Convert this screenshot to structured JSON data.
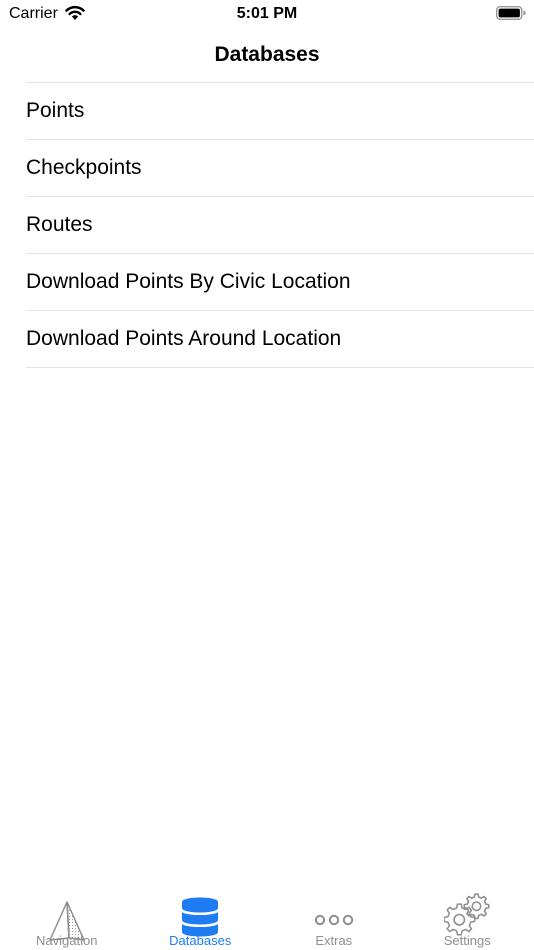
{
  "status_bar": {
    "carrier": "Carrier",
    "time": "5:01 PM"
  },
  "nav": {
    "title": "Databases"
  },
  "list": {
    "items": [
      {
        "label": "Points"
      },
      {
        "label": "Checkpoints"
      },
      {
        "label": "Routes"
      },
      {
        "label": "Download Points By Civic Location"
      },
      {
        "label": "Download Points Around Location"
      }
    ]
  },
  "tab_bar": {
    "tabs": [
      {
        "label": "Navigation",
        "icon": "navigation-arrow-icon",
        "active": false
      },
      {
        "label": "Databases",
        "icon": "database-icon",
        "active": true
      },
      {
        "label": "Extras",
        "icon": "more-dots-icon",
        "active": false
      },
      {
        "label": "Settings",
        "icon": "gears-icon",
        "active": false
      }
    ]
  },
  "colors": {
    "accent": "#1e7cf2",
    "inactive": "#8e8e93",
    "separator": "#e3e3e6"
  }
}
